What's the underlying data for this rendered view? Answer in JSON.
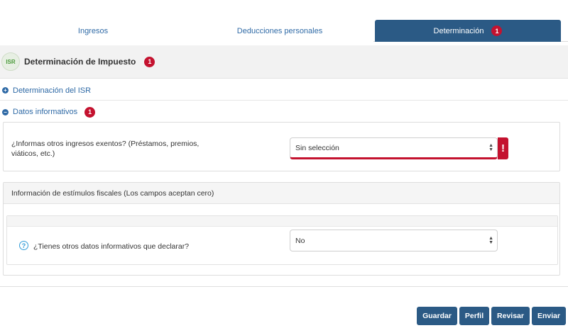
{
  "tabs": [
    {
      "label": "Ingresos"
    },
    {
      "label": "Deducciones personales"
    },
    {
      "label": "Determinación",
      "badge": "1"
    }
  ],
  "section": {
    "icon_text": "ISR",
    "title": "Determinación de Impuesto",
    "badge": "1"
  },
  "collapsibles": {
    "isr": {
      "icon": "+",
      "label": "Determinación del ISR"
    },
    "datos": {
      "icon": "−",
      "label": "Datos informativos",
      "badge": "1"
    }
  },
  "question_ingresos": {
    "label": "¿Informas otros ingresos exentos? (Préstamos, premios, viáticos, etc.)",
    "value": "Sin selección",
    "error_icon": "!"
  },
  "estimulos": {
    "title": "Información de estímulos fiscales (Los campos aceptan cero)",
    "help_icon": "?",
    "question": "¿Tienes otros datos informativos que declarar?",
    "value": "No"
  },
  "buttons": {
    "guardar": "Guardar",
    "perfil": "Perfil",
    "revisar": "Revisar",
    "enviar": "Enviar"
  },
  "colors": {
    "primary": "#2b5a85",
    "link": "#2f6aa6",
    "badge": "#c4122f"
  }
}
